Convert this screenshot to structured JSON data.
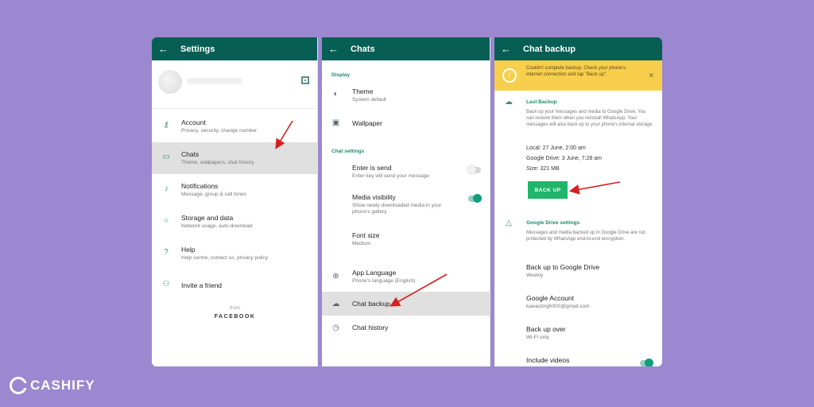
{
  "colors": {
    "background": "#9b88d0",
    "appbar": "#075e54",
    "accent": "#1fb56a",
    "banner": "#f7cf4d"
  },
  "settings": {
    "title": "Settings",
    "items": [
      {
        "icon": "key-icon",
        "title": "Account",
        "subtitle": "Privacy, security, change number"
      },
      {
        "icon": "chat-icon",
        "title": "Chats",
        "subtitle": "Theme, wallpapers, chat history"
      },
      {
        "icon": "bell-icon",
        "title": "Notifications",
        "subtitle": "Message, group & call tones"
      },
      {
        "icon": "data-icon",
        "title": "Storage and data",
        "subtitle": "Network usage, auto-download"
      },
      {
        "icon": "help-icon",
        "title": "Help",
        "subtitle": "Help centre, contact us, privacy policy"
      },
      {
        "icon": "people-icon",
        "title": "Invite a friend",
        "subtitle": ""
      }
    ],
    "from_label": "from",
    "brand": "FACEBOOK"
  },
  "chats": {
    "title": "Chats",
    "display_label": "Display",
    "theme": {
      "title": "Theme",
      "subtitle": "System default"
    },
    "wallpaper": {
      "title": "Wallpaper"
    },
    "chat_settings_label": "Chat settings",
    "enter_send": {
      "title": "Enter is send",
      "subtitle": "Enter key will send your message",
      "enabled": false
    },
    "media_visibility": {
      "title": "Media visibility",
      "subtitle1": "Show newly downloaded media in your",
      "subtitle2": "phone's gallery",
      "enabled": true
    },
    "font_size": {
      "title": "Font size",
      "subtitle": "Medium"
    },
    "app_language": {
      "title": "App Language",
      "subtitle": "Phone's language (English)"
    },
    "chat_backup": {
      "title": "Chat backup"
    },
    "chat_history": {
      "title": "Chat history"
    }
  },
  "backup": {
    "title": "Chat backup",
    "banner_text": "Couldn't complete backup. Check your phone's internet connection and tap \"Back up\".",
    "last_backup_label": "Last Backup",
    "last_backup_desc": "Back up your messages and media to Google Drive. You can restore them when you reinstall WhatsApp. Your messages will also back up to your phone's internal storage.",
    "local": "Local: 27 June, 2:00 am",
    "drive": "Google Drive: 3 June, 7:28 am",
    "size": "Size: 321 MB",
    "button": "BACK UP",
    "gdrive_label": "Google Drive settings",
    "gdrive_desc": "Messages and media backed up in Google Drive are not protected by WhatsApp end-to-end encryption.",
    "backup_to": {
      "title": "Back up to Google Drive",
      "subtitle": "Weekly"
    },
    "account": {
      "title": "Google Account",
      "subtitle": "kawastingh000@gmail.com"
    },
    "backup_over": {
      "title": "Back up over",
      "subtitle": "Wi-Fi only"
    },
    "include_videos": {
      "title": "Include videos",
      "enabled": true
    }
  },
  "watermark": "CASHIFY"
}
